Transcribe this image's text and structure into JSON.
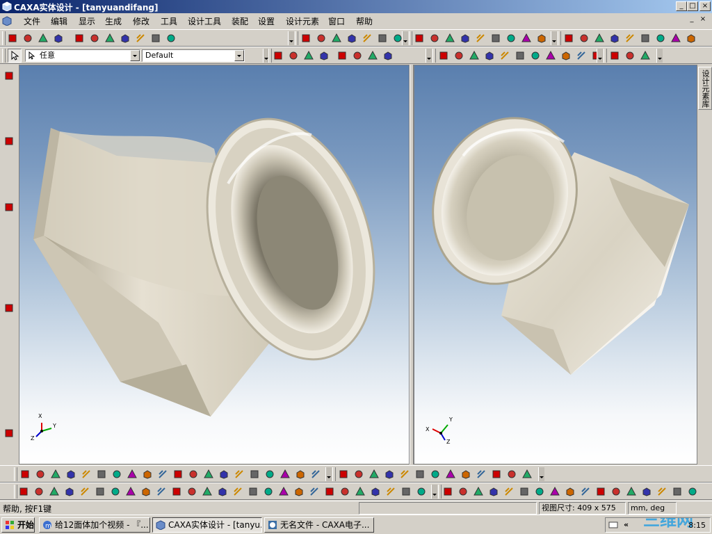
{
  "window": {
    "title": "CAXA实体设计 - [tanyuandifang]",
    "controls": [
      "_",
      "□",
      "×"
    ]
  },
  "menu": [
    "文件",
    "编辑",
    "显示",
    "生成",
    "修改",
    "工具",
    "设计工具",
    "装配",
    "设置",
    "设计元素",
    "窗口",
    "帮助"
  ],
  "selection": {
    "filter_value": "任意",
    "style_value": "Default"
  },
  "right_panel": {
    "tab_label": "设计元素库"
  },
  "viewports": {
    "left": {
      "axes": {
        "x": "X",
        "y": "Y",
        "z": "Z"
      }
    },
    "right": {
      "axes": {
        "x": "X",
        "y": "Y",
        "z": "Z"
      }
    }
  },
  "status": {
    "help_text": "帮助, 按F1键",
    "view_size": "视图尺寸: 409 x 575",
    "units": "mm, deg"
  },
  "taskbar": {
    "start_label": "开始",
    "tasks": [
      {
        "label": "给12面体加个视频 - 『...",
        "active": false
      },
      {
        "label": "CAXA实体设计 - [tanyu...",
        "active": true
      },
      {
        "label": "无名文件 - CAXA电子...",
        "active": false
      }
    ],
    "clock": "8:15",
    "watermark": "三维网"
  },
  "colors": {
    "title_start": "#0a246a",
    "title_end": "#a6caf0",
    "model_surface": "#d6cfbd",
    "viewport_top": "#5a7fae",
    "viewport_bottom": "#ffffff"
  }
}
